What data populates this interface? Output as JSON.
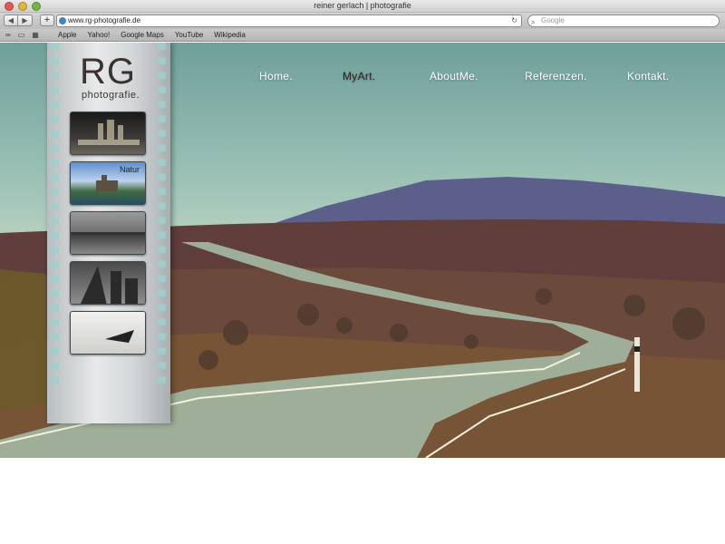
{
  "browser": {
    "window_title": "reiner gerlach | photografie",
    "url": "www.rg-photografie.de",
    "search_placeholder": "Google",
    "back_label": "◀",
    "forward_label": "▶",
    "add_label": "+",
    "reload_label": "↻",
    "bookmarks": [
      "Apple",
      "Yahoo!",
      "Google Maps",
      "YouTube",
      "Wikipedia"
    ]
  },
  "site": {
    "logo": "RG",
    "logo_sub": "photografie.",
    "nav": [
      "Home.",
      "MyArt.",
      "AboutMe.",
      "Referenzen.",
      "Kontakt."
    ],
    "active_nav": "MyArt.",
    "thumbnails": [
      {
        "label": "",
        "icon": "city-night-photo"
      },
      {
        "label": "Natur",
        "icon": "castle-lake-photo"
      },
      {
        "label": "",
        "icon": "harbor-reflection-photo"
      },
      {
        "label": "",
        "icon": "skyscraper-photo"
      },
      {
        "label": "",
        "icon": "boat-beach-photo"
      }
    ]
  }
}
